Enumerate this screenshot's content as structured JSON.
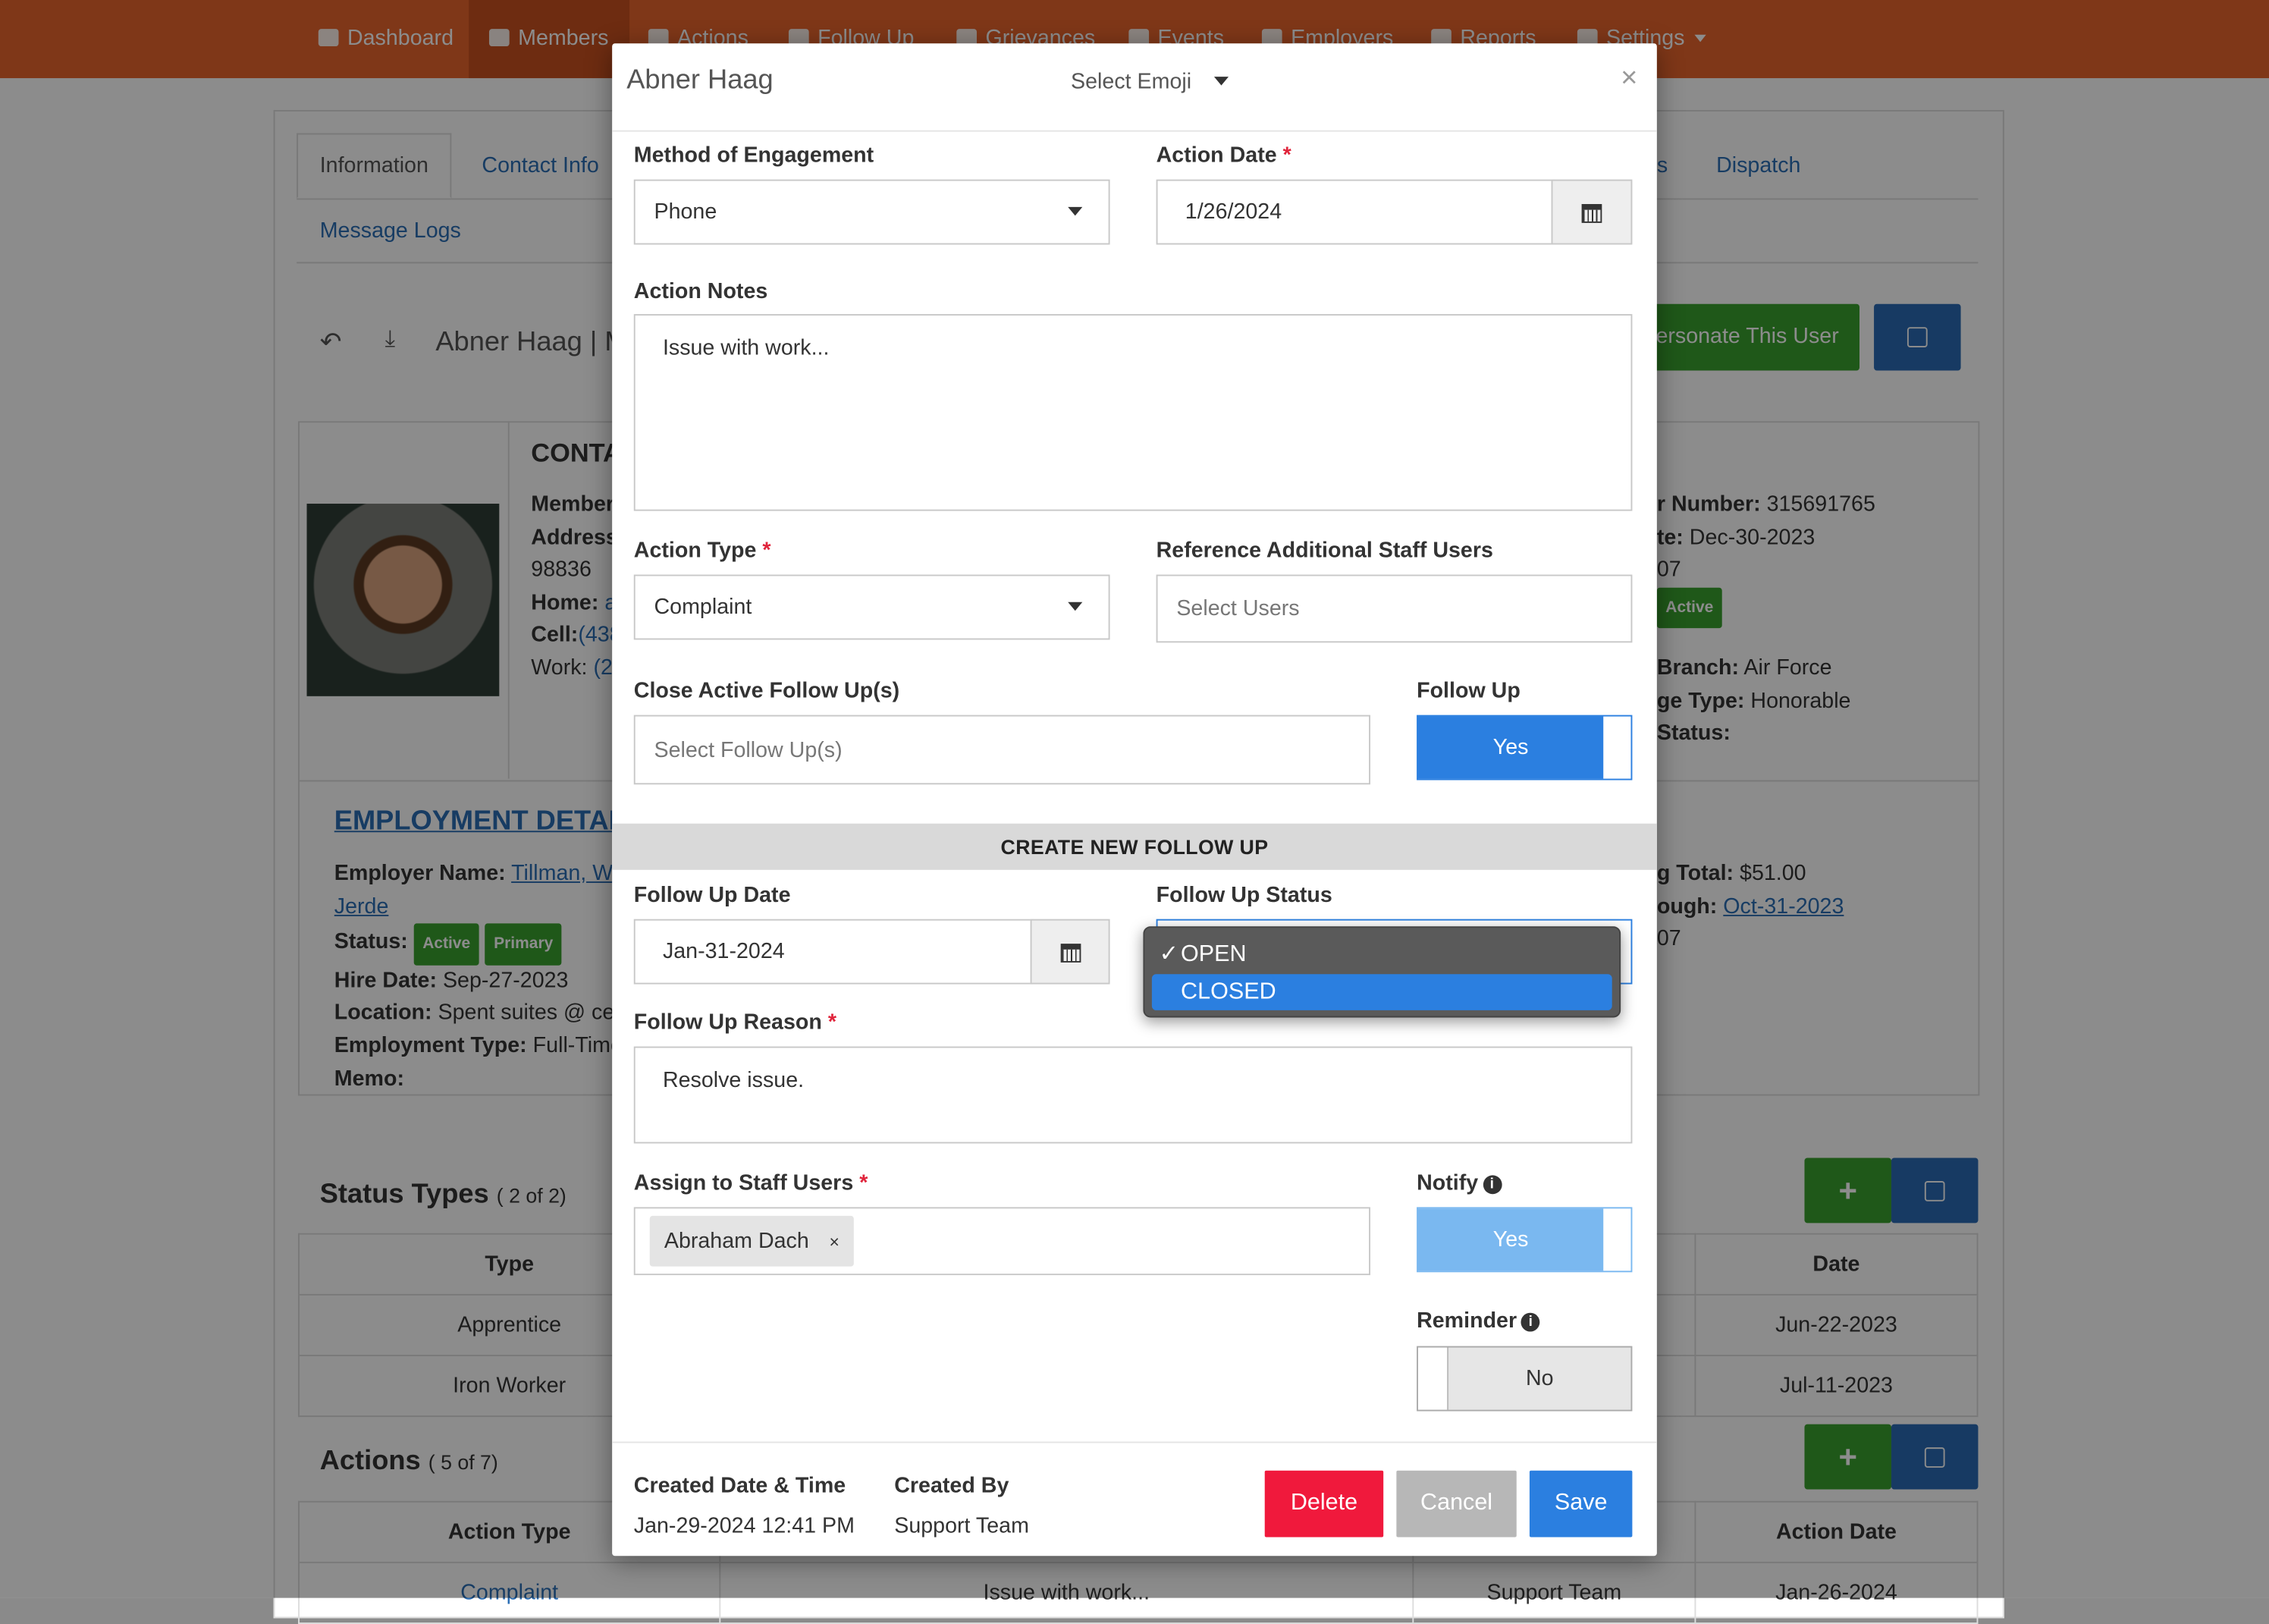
{
  "nav": {
    "items": [
      "Dashboard",
      "Members",
      "Actions",
      "Follow Up",
      "Grievances",
      "Events",
      "Employers",
      "Reports",
      "Settings"
    ]
  },
  "page": {
    "tabs": [
      "Information",
      "Contact Info",
      "Dispatch",
      "Message Logs"
    ],
    "tab_partial": "s",
    "header_title": "Abner Haag | M",
    "impersonate_button": "ersonate This User",
    "contact_heading": "CONTA",
    "left_fields": [
      "Member",
      "Address",
      "98836",
      "Home:",
      "Cell:",
      "Work:"
    ],
    "left_values": [
      "",
      "",
      "",
      "a",
      "(438",
      "(2"
    ],
    "right_fields": [
      {
        "label": "r Number:",
        "value": "315691765"
      },
      {
        "label": "te:",
        "value": "Dec-30-2023"
      },
      {
        "label": "",
        "value": "07"
      },
      {
        "label": "Branch:",
        "value": "Air Force"
      },
      {
        "label": "ge Type:",
        "value": "Honorable"
      },
      {
        "label": "Status:",
        "value": ""
      }
    ],
    "right_badge": "Active",
    "employment": {
      "heading": "EMPLOYMENT DETAILS",
      "employer_label": "Employer Name:",
      "employer_value": "Tillman, Wo",
      "employer_value2": "Jerde",
      "status_label": "Status:",
      "badges": [
        "Active",
        "Primary"
      ],
      "hire_label": "Hire Date:",
      "hire_value": "Sep-27-2023",
      "location_label": "Location:",
      "location_value": "Spent suites @ cent",
      "type_label": "Employment Type:",
      "type_value": "Full-Time",
      "memo_label": "Memo:"
    },
    "dues": {
      "total_label": "g Total:",
      "total_value": "$51.00",
      "through_label": "ough:",
      "through_value": "Oct-31-2023",
      "extra": "07"
    },
    "status_types": {
      "title": "Status Types",
      "count": "( 2 of 2)",
      "col_type": "Type",
      "col_date": "Date",
      "rows": [
        {
          "type": "Apprentice",
          "date": "Jun-22-2023"
        },
        {
          "type": "Iron Worker",
          "date": "Jul-11-2023"
        }
      ]
    },
    "actions": {
      "title": "Actions",
      "count": "( 5 of 7)",
      "col_type": "Action Type",
      "col_date": "Action Date",
      "row": {
        "type": "Complaint",
        "notes": "Issue with work...",
        "by": "Support Team",
        "date": "Jan-26-2024"
      }
    }
  },
  "modal": {
    "title": "Abner Haag",
    "emoji_select": "Select Emoji",
    "close": "×",
    "method_label": "Method of Engagement",
    "method_value": "Phone",
    "action_date_label": "Action Date",
    "action_date_value": "1/26/2024",
    "notes_label": "Action Notes",
    "notes_value": "Issue with work...",
    "action_type_label": "Action Type",
    "action_type_value": "Complaint",
    "ref_staff_label": "Reference Additional Staff Users",
    "ref_staff_placeholder": "Select Users",
    "close_followups_label": "Close Active Follow Up(s)",
    "close_followups_placeholder": "Select Follow Up(s)",
    "follow_up_label": "Follow Up",
    "follow_up_value": "Yes",
    "section_title": "CREATE NEW FOLLOW UP",
    "fu_date_label": "Follow Up Date",
    "fu_date_value": "Jan-31-2024",
    "fu_status_label": "Follow Up Status",
    "fu_status_options": [
      "OPEN",
      "CLOSED"
    ],
    "fu_status_checked": "✓",
    "fu_reason_label": "Follow Up Reason",
    "fu_reason_value": "Resolve issue.",
    "assign_label": "Assign to Staff Users",
    "assign_tag": "Abraham Dach",
    "assign_tag_remove": "×",
    "notify_label": "Notify",
    "notify_value": "Yes",
    "reminder_label": "Reminder",
    "reminder_value": "No",
    "required_mark": "*",
    "info_icon_glyph": "i",
    "created_label": "Created Date & Time",
    "created_value": "Jan-29-2024 12:41 PM",
    "created_by_label": "Created By",
    "created_by_value": "Support Team",
    "delete_button": "Delete",
    "cancel_button": "Cancel",
    "save_button": "Save"
  },
  "colors": {
    "navbar": "#e8642d",
    "primary": "#2b7fe0",
    "success": "#3aa02f",
    "danger": "#f0193c",
    "secondary": "#b7b7b7"
  }
}
